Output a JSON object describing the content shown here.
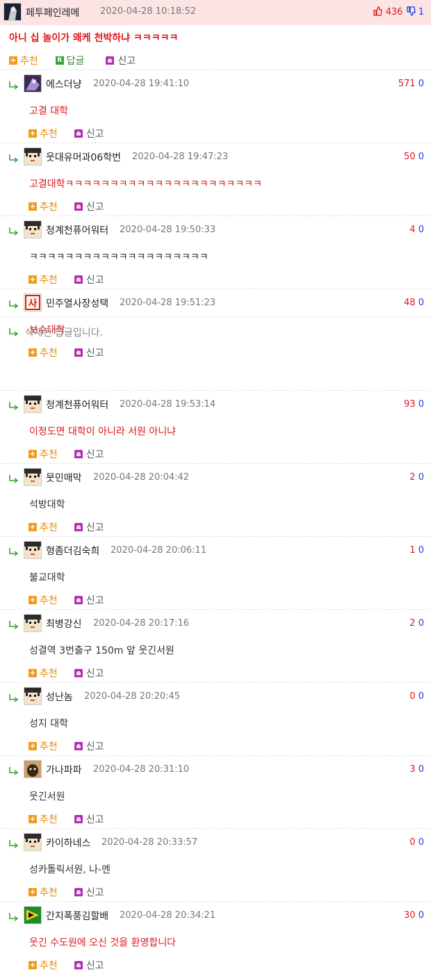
{
  "post": {
    "nickname": "페투페인레메",
    "datetime": "2020-04-28 10:18:52",
    "upvotes": "436",
    "downvotes": "1",
    "text": "아니 십 놀이가 왜케 천박하냐 ㅋㅋㅋㅋㅋ",
    "actions": {
      "recommend": "추천",
      "reply": "답글",
      "report": "신고"
    }
  },
  "labels": {
    "recommend": "추천",
    "report": "신고"
  },
  "deleted_reply": "삭제된 답글입니다.",
  "colors": {
    "header_bg": "#fde4e4",
    "red": "#e0171b",
    "blue": "#1a3ee0",
    "orange": "#e38a08"
  },
  "comments": [
    {
      "nickname": "에스더냥",
      "datetime": "2020-04-28 19:41:10",
      "up": "571",
      "down": "0",
      "text": "고결 대학",
      "avatar": "dark-character-avatar",
      "red": true
    },
    {
      "nickname": "웃대유머과06학번",
      "datetime": "2020-04-28 19:47:23",
      "up": "50",
      "down": "0",
      "text": "고결대학ㅋㅋㅋㅋㅋㅋㅋㅋㅋㅋㅋㅋㅋㅋㅋㅋㅋㅋㅋㅋㅋㅋ",
      "avatar": "default-avatar",
      "red": true
    },
    {
      "nickname": "청계천퓨어워터",
      "datetime": "2020-04-28 19:50:33",
      "up": "4",
      "down": "0",
      "text": "ㅋㅋㅋㅋㅋㅋㅋㅋㅋㅋㅋㅋㅋㅋㅋㅋㅋㅋㅋㅋ",
      "avatar": "default-avatar",
      "red": false
    },
    {
      "nickname": "민주열사장성택",
      "datetime": "2020-04-28 19:51:23",
      "up": "48",
      "down": "0",
      "text": "보수대학",
      "avatar": "red-seal-avatar",
      "red": true
    },
    {
      "nickname": "청계천퓨어워터",
      "datetime": "2020-04-28 19:53:14",
      "up": "93",
      "down": "0",
      "text": "이정도면 대학이 아니라 서원 아니냐",
      "avatar": "default-avatar",
      "red": true
    },
    {
      "nickname": "뭇민매막",
      "datetime": "2020-04-28 20:04:42",
      "up": "2",
      "down": "0",
      "text": "석방대학",
      "avatar": "default-avatar",
      "red": false
    },
    {
      "nickname": "형좀더김숙희",
      "datetime": "2020-04-28 20:06:11",
      "up": "1",
      "down": "0",
      "text": "불교대학",
      "avatar": "default-avatar",
      "red": false
    },
    {
      "nickname": "최병강신",
      "datetime": "2020-04-28 20:17:16",
      "up": "2",
      "down": "0",
      "text": "성결역 3번출구 150m 앞 웃긴서원",
      "avatar": "default-avatar",
      "red": false
    },
    {
      "nickname": "성난놈",
      "datetime": "2020-04-28 20:20:45",
      "up": "0",
      "down": "0",
      "text": "성지 대학",
      "avatar": "default-avatar",
      "red": false
    },
    {
      "nickname": "가나파파",
      "datetime": "2020-04-28 20:31:10",
      "up": "3",
      "down": "0",
      "text": "웃긴서원",
      "avatar": "dog-photo-avatar",
      "red": false
    },
    {
      "nickname": "카이하네스",
      "datetime": "2020-04-28 20:33:57",
      "up": "0",
      "down": "0",
      "text": "성카톨릭서원, 나-멘",
      "avatar": "default-avatar",
      "red": false
    },
    {
      "nickname": "간지폭풍김할배",
      "datetime": "2020-04-28 20:34:21",
      "up": "30",
      "down": "0",
      "text": "웃긴 수도원에 오신 것을 환영합니다",
      "avatar": "green-triangle-avatar",
      "red": true
    }
  ]
}
